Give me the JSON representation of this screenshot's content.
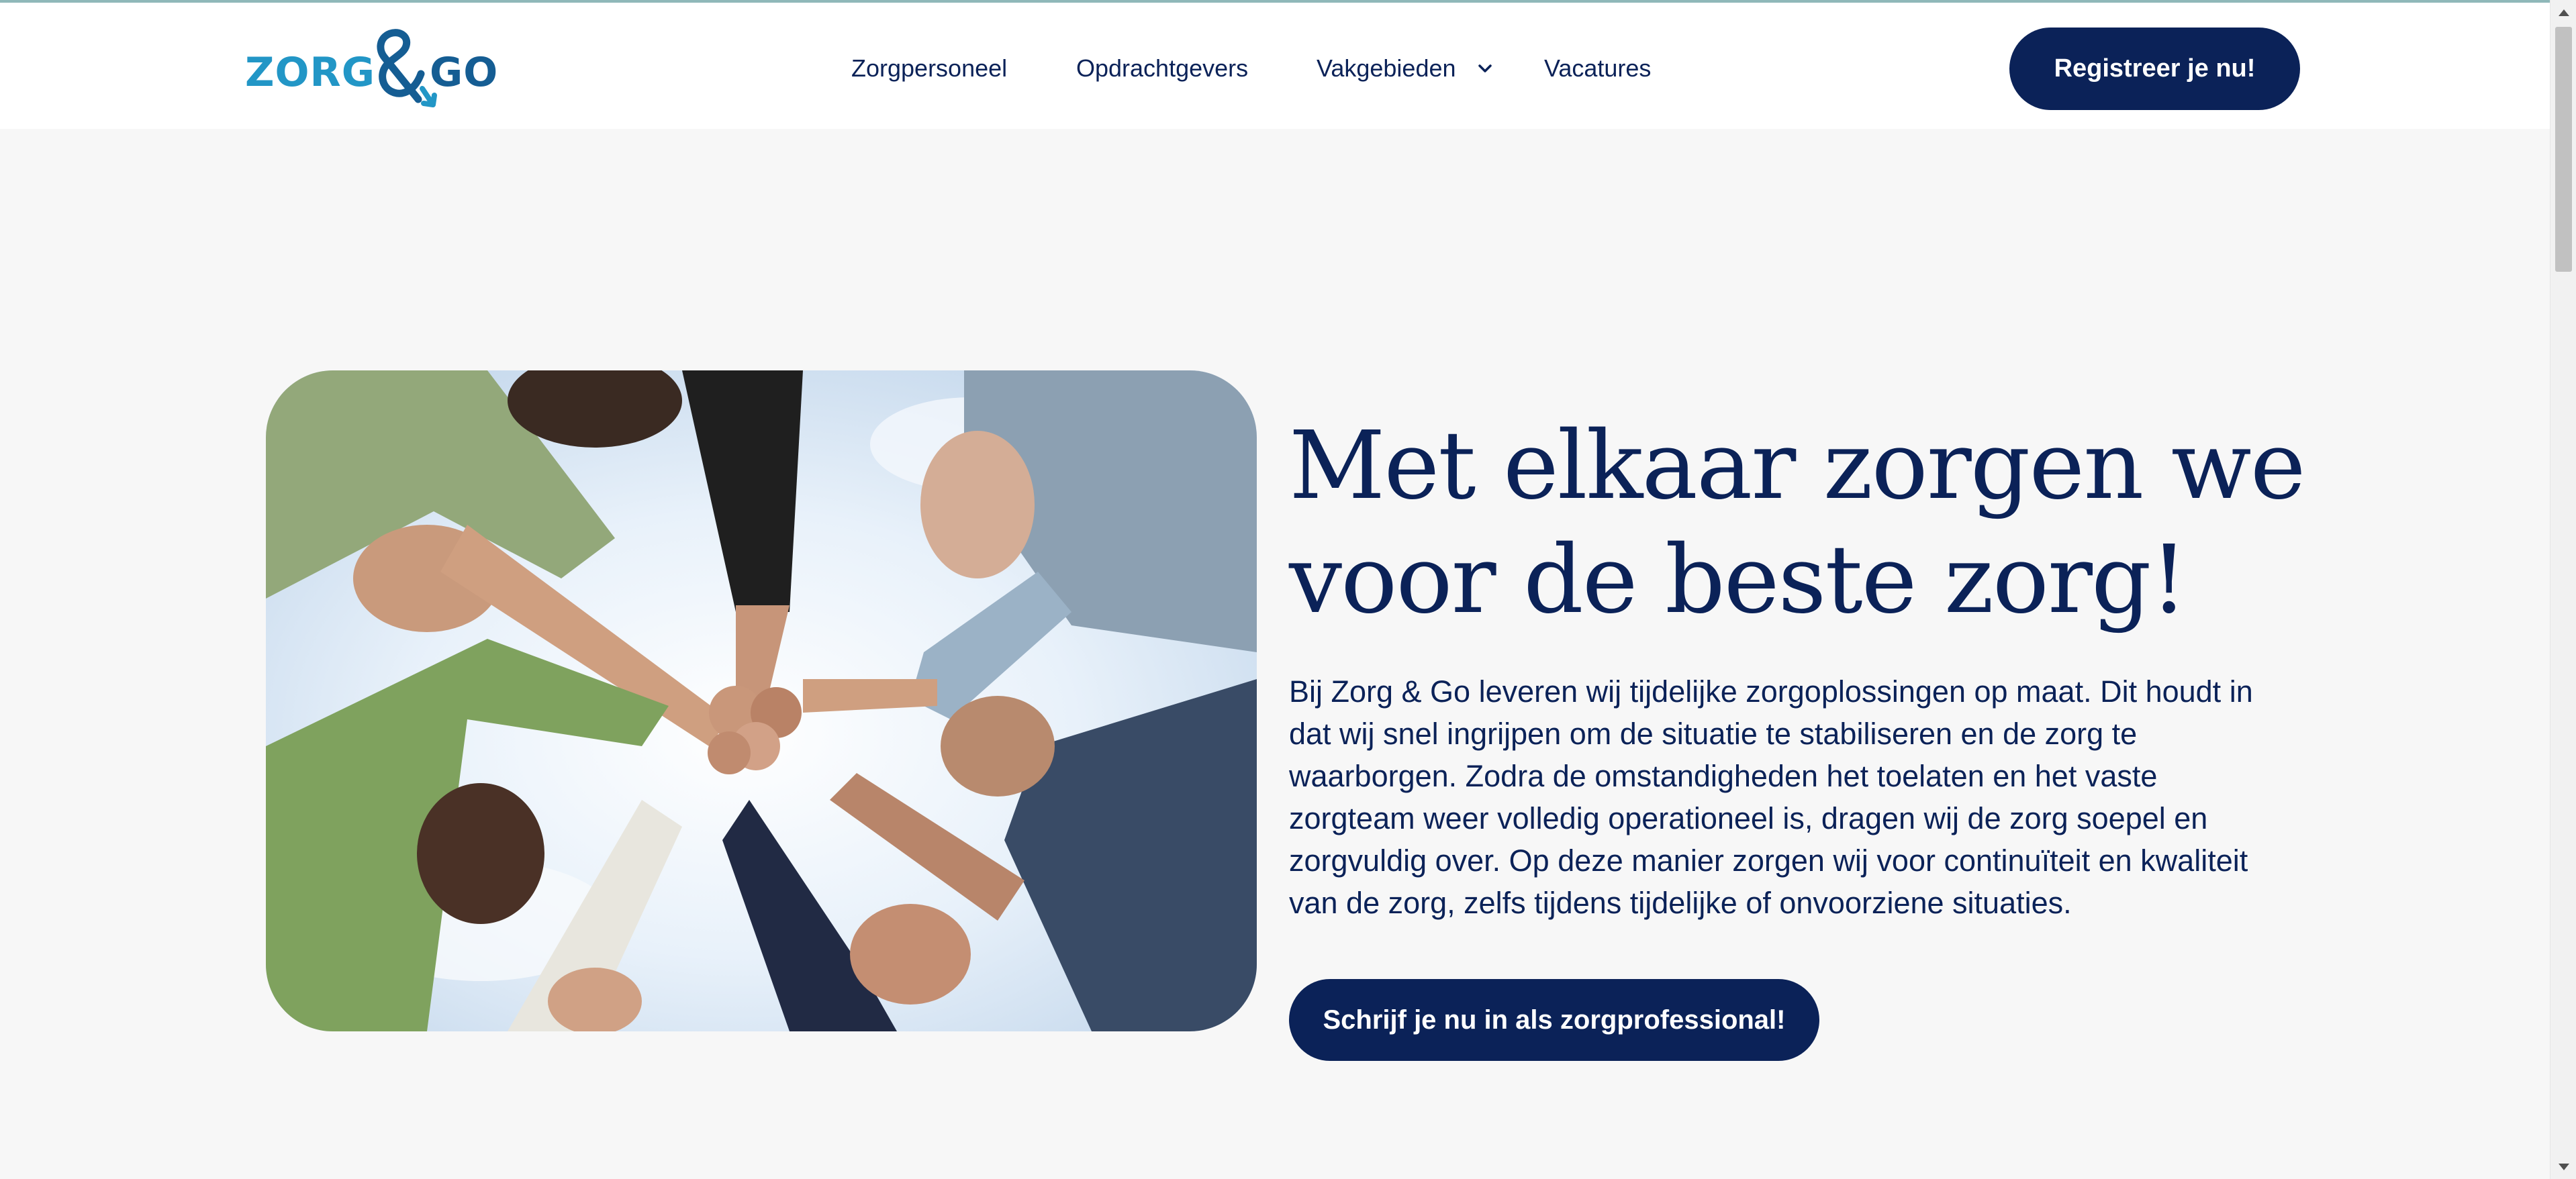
{
  "header": {
    "logo": {
      "text_left": "ZORG",
      "text_amp": "&",
      "text_right": "GO"
    },
    "nav": [
      {
        "label": "Zorgpersoneel"
      },
      {
        "label": "Opdrachtgevers"
      },
      {
        "label": "Vakgebieden",
        "icon": "chevron-down-icon"
      },
      {
        "label": "Vacatures"
      }
    ],
    "cta_label": "Registreer je nu!"
  },
  "hero": {
    "image_alt": "Groep mensen die hun vuisten samenbrengen, van onderaf gefotografeerd",
    "headline_line1": "Met elkaar zorgen we",
    "headline_line2": "voor de beste zorg!",
    "body": "Bij Zorg & Go leveren wij tijdelijke zorgoplossingen op maat. Dit houdt in dat wij snel ingrijpen om de situatie te stabiliseren en de zorg te waarborgen. Zodra de omstandigheden het toelaten en het vaste zorgteam weer volledig operationeel is, dragen wij de zorg soepel en zorgvuldig over. Op deze manier zorgen wij voor continuïteit en kwaliteit van de zorg, zelfs tijdens tijdelijke of onvoorziene situaties.",
    "cta_label": "Schrijf je nu in als zorgprofessional!"
  },
  "colors": {
    "navy": "#0b2258",
    "logo_light_blue": "#2296c6",
    "logo_dark_blue": "#155d93",
    "page_background": "#f7f7f7"
  }
}
